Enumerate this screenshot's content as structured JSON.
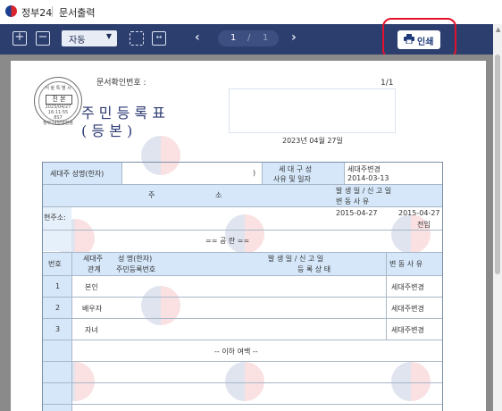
{
  "window": {
    "app_name": "정부24",
    "title": "문서출력"
  },
  "toolbar": {
    "zoom_value": "자동",
    "page_current": "1",
    "page_separator": "/",
    "page_total": "1",
    "print_label": "인쇄",
    "icons": [
      "zoom-in-icon",
      "zoom-out-icon",
      "chevron-down-icon",
      "fit-page-icon",
      "fit-width-icon",
      "chevron-left-icon",
      "chevron-right-icon",
      "printer-icon"
    ]
  },
  "colors": {
    "toolbar": "#2c3e6e",
    "highlight": "#e3122c",
    "table_band": "#d5e7f9",
    "title": "#2e3b73"
  },
  "doc": {
    "confirm_label": "문서확인번호 :",
    "page_mark": "1/1",
    "seal": {
      "line1": "서 울 특 별 시",
      "center": "진 본",
      "date": "2023/04/27",
      "time": "16:11:55",
      "code": "8S7",
      "bottom": "정부24발행전용"
    },
    "title": "주 민 등 록 표",
    "subtitle": "( 등          본 )",
    "issue_date": "2023년 04월 27일",
    "household": {
      "head_label": "세대주 성명(한자)",
      "paren": ")",
      "reason_label_1": "세 대 구 성",
      "reason_label_2": "사유 및 일자",
      "reason_value": "세대주변경",
      "reason_date": "2014-03-13"
    },
    "address": {
      "header_col1": "주",
      "header_col2": "소",
      "header_right_1": "발 생 일  /  신 고 일",
      "header_right_2": "변          동          사          유",
      "current_label": "현주소:",
      "date1": "2015-04-27",
      "date2": "2015-04-27",
      "reason": "전입",
      "blank_note": "== 공 란 =="
    },
    "members": {
      "col_no": "번호",
      "col_relation_1": "세대주",
      "col_relation_2": "관계",
      "col_name_1": "성 명(한자)",
      "col_name_2": "주민등록번호",
      "col_dates_1": "발 생 일  /  신 고 일",
      "col_dates_2": "등 록 상 태",
      "col_reason": "변 동 사 유",
      "rows": [
        {
          "no": "1",
          "relation": "본인",
          "reason": "세대주변경"
        },
        {
          "no": "2",
          "relation": "배우자",
          "reason": "세대주변경"
        },
        {
          "no": "3",
          "relation": "자녀",
          "reason": "세대주변경"
        }
      ],
      "end_note": "-- 이하 여백 --"
    }
  }
}
